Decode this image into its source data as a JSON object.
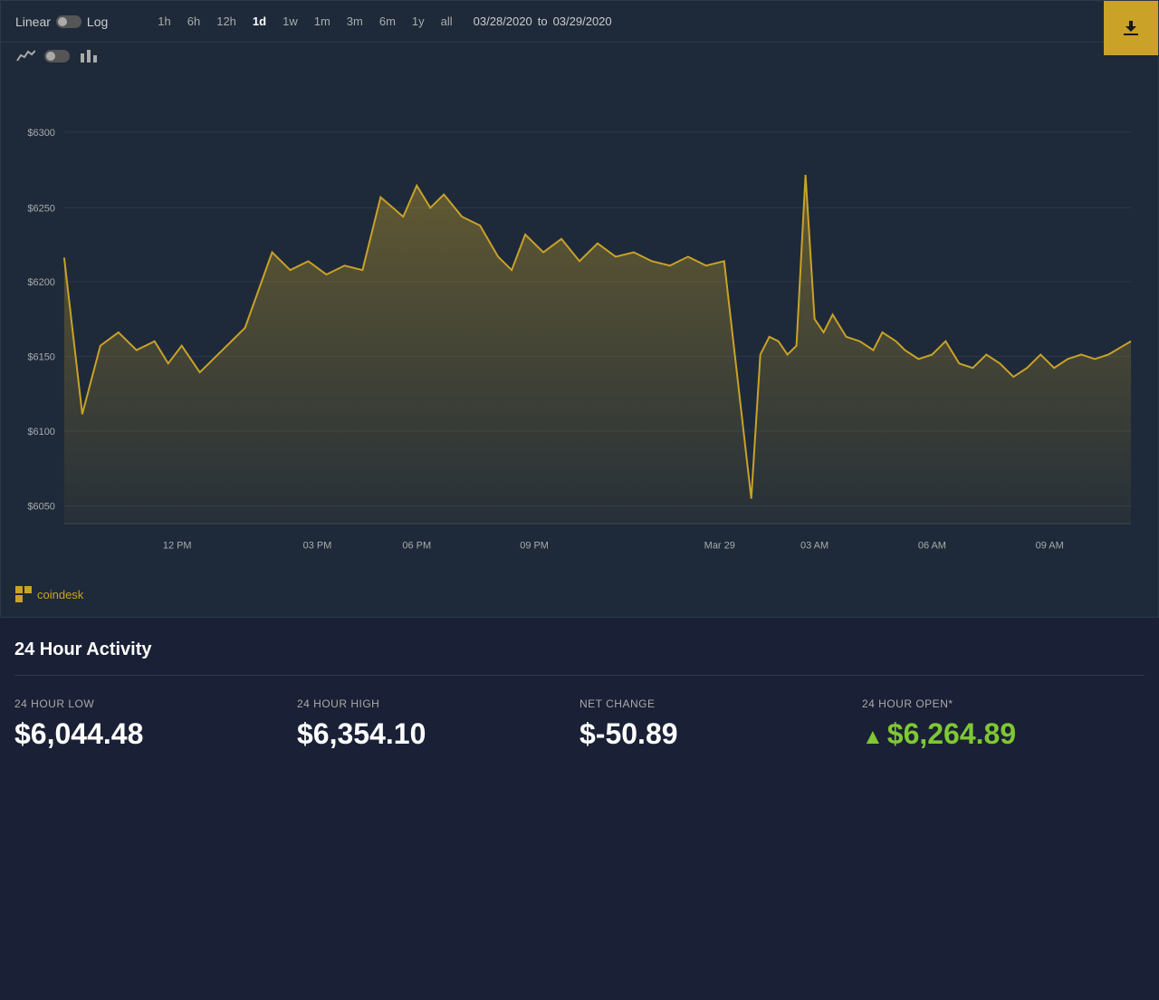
{
  "toolbar": {
    "scale_linear": "Linear",
    "scale_log": "Log",
    "time_buttons": [
      "1h",
      "6h",
      "12h",
      "1d",
      "1w",
      "1m",
      "3m",
      "6m",
      "1y",
      "all"
    ],
    "active_time": "1d",
    "date_from": "03/28/2020",
    "date_to": "03/29/2020",
    "date_separator": "to",
    "download_icon": "⬇"
  },
  "chart_type": {
    "line_icon": "line",
    "bar_icon": "bar"
  },
  "y_axis": {
    "labels": [
      "$6300",
      "$6250",
      "$6200",
      "$6150",
      "$6100",
      "$6050"
    ]
  },
  "x_axis": {
    "labels": [
      "12 PM",
      "03 PM",
      "06 PM",
      "09 PM",
      "Mar 29",
      "03 AM",
      "06 AM",
      "09 AM"
    ]
  },
  "coindesk": {
    "label": "coindesk"
  },
  "activity": {
    "title": "24 Hour Activity",
    "stats": [
      {
        "label": "24 HOUR LOW",
        "value": "$6,044.48",
        "color": "white"
      },
      {
        "label": "24 HOUR HIGH",
        "value": "$6,354.10",
        "color": "white"
      },
      {
        "label": "NET CHANGE",
        "value": "$-50.89",
        "color": "white"
      },
      {
        "label": "24 HOUR OPEN*",
        "value": "$6,264.89",
        "color": "green"
      }
    ]
  }
}
